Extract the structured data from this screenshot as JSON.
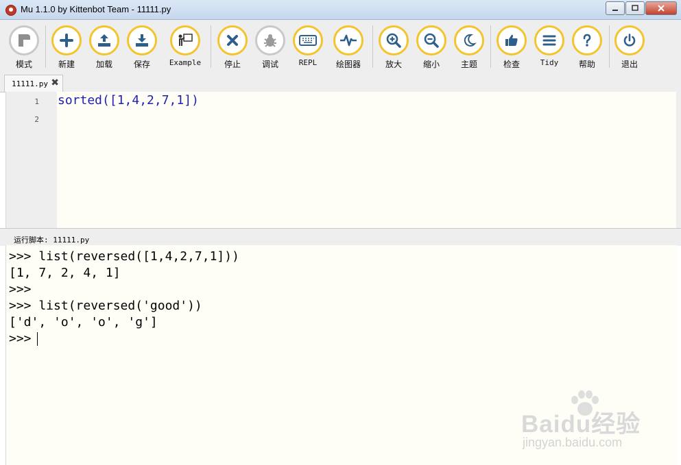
{
  "window": {
    "title": "Mu 1.1.0 by Kittenbot Team - 11111.py",
    "minimize_icon": "minimize-icon",
    "maximize_icon": "maximize-icon",
    "close_icon": "close-icon"
  },
  "toolbar": {
    "buttons": [
      {
        "label": "模式",
        "icon": "mode-icon"
      },
      {
        "label": "新建",
        "icon": "plus-icon"
      },
      {
        "label": "加载",
        "icon": "upload-icon"
      },
      {
        "label": "保存",
        "icon": "download-icon"
      },
      {
        "label": "Example",
        "icon": "presenter-icon"
      },
      {
        "label": "停止",
        "icon": "close-x-icon"
      },
      {
        "label": "调试",
        "icon": "bug-icon"
      },
      {
        "label": "REPL",
        "icon": "keyboard-icon"
      },
      {
        "label": "绘图器",
        "icon": "pulse-icon"
      },
      {
        "label": "放大",
        "icon": "zoom-in-icon"
      },
      {
        "label": "缩小",
        "icon": "zoom-out-icon"
      },
      {
        "label": "主题",
        "icon": "moon-icon"
      },
      {
        "label": "检查",
        "icon": "thumbs-up-icon"
      },
      {
        "label": "Tidy",
        "icon": "lines-icon"
      },
      {
        "label": "帮助",
        "icon": "question-icon"
      },
      {
        "label": "退出",
        "icon": "power-icon"
      }
    ]
  },
  "tabs": [
    {
      "label": "11111.py"
    }
  ],
  "editor": {
    "line_numbers": [
      "1",
      "2"
    ],
    "lines": [
      "sorted([1,4,2,7,1])",
      ""
    ]
  },
  "run_pane": {
    "label": "运行脚本: 11111.py"
  },
  "repl": {
    "lines": [
      ">>> list(reversed([1,4,2,7,1]))",
      "[1, 7, 2, 4, 1]",
      ">>>",
      ">>> list(reversed('good'))",
      "['d', 'o', 'o', 'g']",
      ">>>"
    ]
  },
  "watermark": {
    "brand": "Baidu经验",
    "url": "jingyan.baidu.com"
  },
  "colors": {
    "accent_ring": "#f4c42d",
    "icon_blue": "#2e5f8a",
    "code_blue": "#1f1fb0",
    "editor_bg": "#fefef7"
  }
}
